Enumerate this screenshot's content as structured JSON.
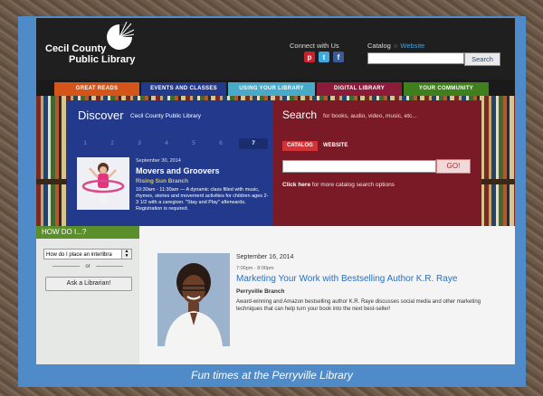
{
  "header": {
    "logo_line1": "Cecil County",
    "logo_line2": "Public Library",
    "connect_label": "Connect with Us",
    "social_icons": [
      "pinterest-icon",
      "twitter-icon",
      "facebook-icon"
    ],
    "catalog_label": "Catalog",
    "website_label": "Website",
    "search_button": "Search"
  },
  "nav": {
    "items": [
      {
        "label": "GREAT READS",
        "color": "#d4541a"
      },
      {
        "label": "EVENTS AND CLASSES",
        "color": "#233a8c"
      },
      {
        "label": "USING YOUR LIBRARY",
        "color": "#49a9c9"
      },
      {
        "label": "DIGITAL LIBRARY",
        "color": "#8a1c3a"
      },
      {
        "label": "YOUR COMMUNITY",
        "color": "#3f7f1e"
      }
    ]
  },
  "discover": {
    "title": "Discover",
    "subtitle": "Cecil County Public Library",
    "tabs": [
      "1",
      "2",
      "3",
      "4",
      "5",
      "6",
      "7"
    ],
    "active_tab": "7",
    "date": "September 30, 2014",
    "event": "Movers and Groovers",
    "branch": "Rising Sun Branch",
    "description": "10:30am - 11:30am — A dynamic class filled with music, rhymes, stories and movement activities for children ages 2-3 1/2 with a caregiver. \"Stay and Play\" afterwards. Registration is required."
  },
  "search": {
    "title": "Search",
    "subtitle": "for books, audio, video, music, etc...",
    "tab_catalog": "CATALOG",
    "tab_website": "WEBSITE",
    "go_button": "GO!",
    "advanced_link": "Click here",
    "advanced_text": " for more catalog search options"
  },
  "howdo": {
    "title": "HOW DO I...?",
    "select_value": "How do I place an interlibra",
    "or_text": "or",
    "ask_button": "Ask a Librarian!"
  },
  "featured": {
    "date": "September 16, 2014",
    "time": "7:00pm - 8:00pm",
    "title": "Marketing Your Work with Bestselling Author K.R. Raye",
    "branch": "Perryville Branch",
    "description": "Award-winning and Amazon bestselling author K.R. Raye discusses social media and other marketing techniques that can help turn your book into the next best-seller!"
  },
  "caption": "Fun times at the Perryville Library"
}
